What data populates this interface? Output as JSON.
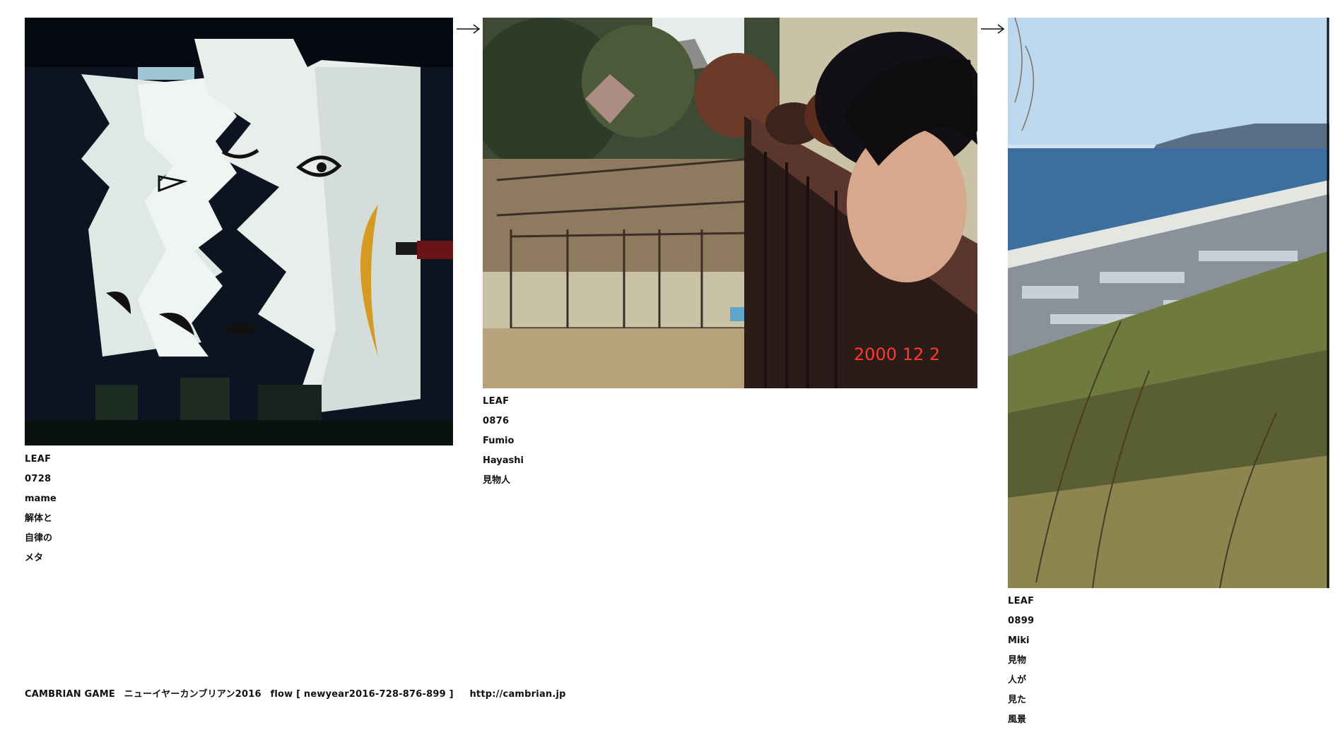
{
  "leaves": [
    {
      "code": "LEAF 0728",
      "author": "mame",
      "title": "解体と自律のメタ",
      "photo": "night-sculpture-faces",
      "colors": {
        "dark": "#0b1420",
        "wall": "#e9f1ec",
        "accent": "#d49a22"
      }
    },
    {
      "code": "LEAF 0876",
      "author": "Fumio Hayashi",
      "title": "見物人",
      "photo": "zoo-railing-onlooker",
      "date_stamp": "2000 12 2",
      "colors": {
        "rail": "#4a2a22",
        "stamp": "#ff3a2a",
        "ground": "#b3a280"
      }
    },
    {
      "code": "LEAF 0899",
      "author": "Miki",
      "title": "見物人が見た風景",
      "photo": "coastal-town-view",
      "colors": {
        "sky": "#cfe3f3",
        "sea": "#3d6f9e",
        "hill": "#6f7a3e"
      }
    }
  ],
  "arrows": [
    "arrow-right-icon",
    "arrow-right-icon"
  ],
  "footer": {
    "label": "CAMBRIAN GAME",
    "event": "ニューイヤーカンブリアン2016",
    "flow": "flow [ newyear2016-728-876-899 ]",
    "url": "http://cambrian.jp"
  }
}
